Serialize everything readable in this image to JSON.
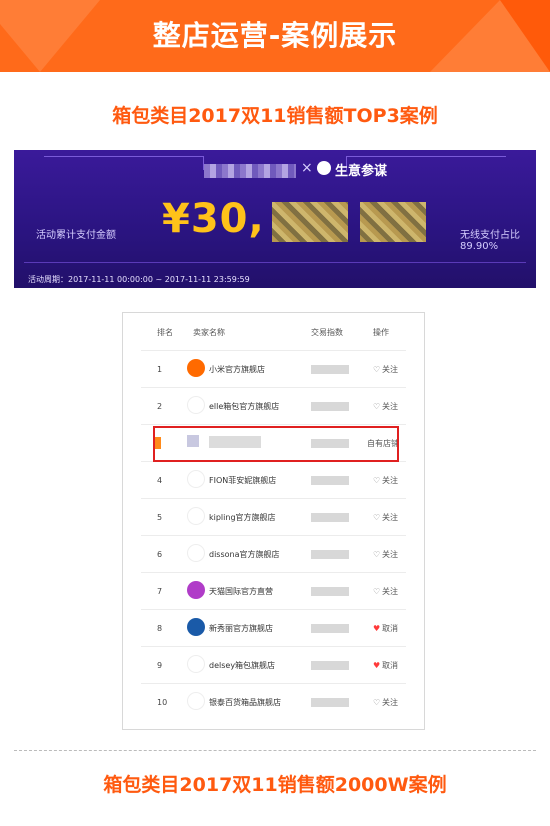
{
  "header": {
    "title": "整店运营-案例展示"
  },
  "section1": {
    "title": "箱包类目2017双11销售额TOP3案例"
  },
  "banner": {
    "logo_text": "生意参谋",
    "left_label": "活动累计支付金额",
    "amount_visible": "¥30,",
    "right_label": "无线支付占比",
    "right_value": "89.90%",
    "period": "活动周期：2017-11-11 00:00:00 ~ 2017-11-11 23:59:59"
  },
  "table": {
    "headers": [
      "排名",
      "卖家名称",
      "交易指数",
      "操作"
    ],
    "rows": [
      {
        "rank": "1",
        "name": "小米官方旗舰店",
        "icon_color": "#ff6a00",
        "op": "关注",
        "heart": "off"
      },
      {
        "rank": "2",
        "name": "elle箱包官方旗舰店",
        "icon_color": "#ffffff",
        "op": "关注",
        "heart": "off"
      },
      {
        "rank": "",
        "name": "",
        "icon_color": "#c8c8e0",
        "op": "自有店铺",
        "heart": "none"
      },
      {
        "rank": "4",
        "name": "FION菲安妮旗舰店",
        "icon_color": "#ffffff",
        "op": "关注",
        "heart": "off"
      },
      {
        "rank": "5",
        "name": "kipling官方旗舰店",
        "icon_color": "#ffffff",
        "op": "关注",
        "heart": "off"
      },
      {
        "rank": "6",
        "name": "dissona官方旗舰店",
        "icon_color": "#ffffff",
        "op": "关注",
        "heart": "off"
      },
      {
        "rank": "7",
        "name": "天猫国际官方直营",
        "icon_color": "#b03cc8",
        "op": "关注",
        "heart": "off"
      },
      {
        "rank": "8",
        "name": "新秀丽官方旗舰店",
        "icon_color": "#1a5aa8",
        "op": "取消",
        "heart": "on"
      },
      {
        "rank": "9",
        "name": "delsey箱包旗舰店",
        "icon_color": "#ffffff",
        "op": "取消",
        "heart": "on"
      },
      {
        "rank": "10",
        "name": "银泰百货箱品旗舰店",
        "icon_color": "#ffffff",
        "op": "关注",
        "heart": "off"
      }
    ]
  },
  "section2": {
    "title": "箱包类目2017双11销售额2000W案例"
  }
}
